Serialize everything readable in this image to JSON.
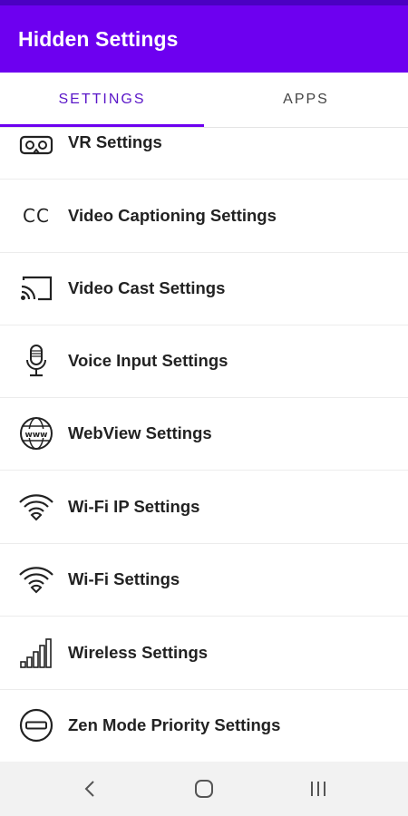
{
  "app": {
    "title": "Hidden Settings",
    "accent_color": "#6d00f0"
  },
  "tabs": [
    {
      "label": "SETTINGS",
      "selected": true
    },
    {
      "label": "APPS",
      "selected": false
    }
  ],
  "items": [
    {
      "label": "VR Settings",
      "icon": "vr-headset-icon"
    },
    {
      "label": "Video Captioning Settings",
      "icon": "closed-caption-icon",
      "icon_text": "CC"
    },
    {
      "label": "Video Cast Settings",
      "icon": "cast-icon"
    },
    {
      "label": "Voice Input Settings",
      "icon": "microphone-icon"
    },
    {
      "label": "WebView Settings",
      "icon": "globe-www-icon",
      "icon_text": "www"
    },
    {
      "label": "Wi-Fi IP Settings",
      "icon": "wifi-icon"
    },
    {
      "label": "Wi-Fi Settings",
      "icon": "wifi-icon"
    },
    {
      "label": "Wireless Settings",
      "icon": "signal-bars-icon"
    },
    {
      "label": "Zen Mode Priority Settings",
      "icon": "do-not-disturb-icon"
    }
  ],
  "navbar": {
    "back": "back-icon",
    "home": "home-icon",
    "recents": "recents-icon"
  }
}
